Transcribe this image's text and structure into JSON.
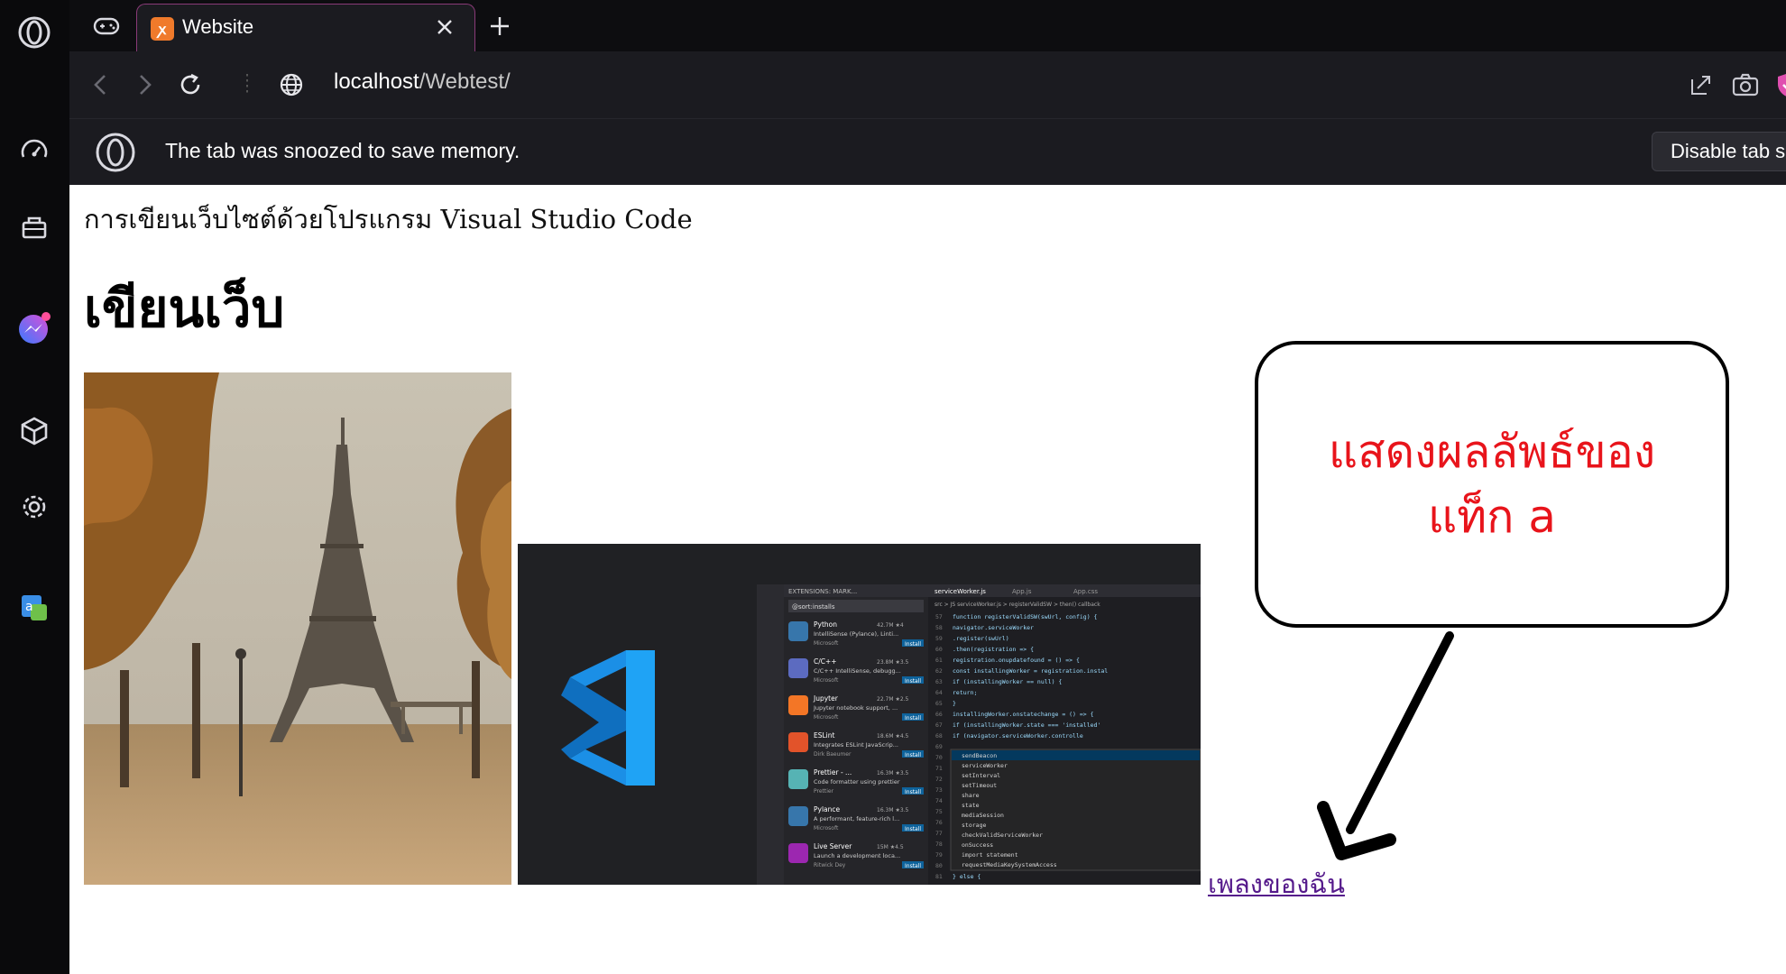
{
  "browser": {
    "tab": {
      "title": "Website",
      "favicon_glyph": "XAMPP"
    },
    "address": {
      "host": "localhost",
      "path": "/Webtest/"
    },
    "infobar": {
      "message": "The tab was snoozed to save memory.",
      "button_label": "Disable tab s"
    },
    "sidebar": {
      "items": [
        "opera-logo-icon",
        "speed-dial-icon",
        "shopping-bag-icon",
        "messenger-icon",
        "cube-icon",
        "settings-icon",
        "translate-icon"
      ]
    }
  },
  "page": {
    "intro_text": "การเขียนเว็บไซต์ด้วยโปรแกรม Visual Studio Code",
    "heading": "เขียนเว็บ",
    "link_text": "เพลงของฉัน"
  },
  "vscode_screenshot": {
    "panel_title": "EXTENSIONS: MARK...",
    "search": "@sort:installs",
    "tabs": [
      "serviceWorker.js",
      "App.js",
      "App.css"
    ],
    "breadcrumb": "src > JS serviceWorker.js > registerValidSW > then() callback",
    "extensions": [
      {
        "name": "Python",
        "desc": "IntelliSense (Pylance), Linti...",
        "publisher": "Microsoft",
        "stats": "42.7M ★4",
        "action": "Install"
      },
      {
        "name": "C/C++",
        "desc": "C/C++ IntelliSense, debugg...",
        "publisher": "Microsoft",
        "stats": "23.8M ★3.5",
        "action": "Install"
      },
      {
        "name": "Jupyter",
        "desc": "Jupyter notebook support, ...",
        "publisher": "Microsoft",
        "stats": "22.7M ★2.5",
        "action": "Install"
      },
      {
        "name": "ESLint",
        "desc": "Integrates ESLint JavaScrip...",
        "publisher": "Dirk Baeumer",
        "stats": "18.6M ★4.5",
        "action": "Install"
      },
      {
        "name": "Prettier - ...",
        "desc": "Code formatter using prettier",
        "publisher": "Prettier",
        "stats": "16.3M ★3.5",
        "action": "Install"
      },
      {
        "name": "Pylance",
        "desc": "A performant, feature-rich l...",
        "publisher": "Microsoft",
        "stats": "16.3M ★3.5",
        "action": "Install"
      },
      {
        "name": "Live Server",
        "desc": "Launch a development loca...",
        "publisher": "Ritwick Dey",
        "stats": "15M ★4.5",
        "action": "Install"
      }
    ],
    "line_numbers": [
      "57",
      "58",
      "59",
      "60",
      "61",
      "62",
      "63",
      "64",
      "65",
      "66",
      "67",
      "68",
      "69",
      "70",
      "71",
      "72",
      "73",
      "74",
      "75",
      "76",
      "77",
      "78",
      "79",
      "80",
      "81"
    ],
    "code_lines": [
      "function registerValidSW(swUrl, config) {",
      "  navigator.serviceWorker",
      "    .register(swUrl)",
      "    .then(registration => {",
      "      registration.onupdatefound = () => {",
      "        const installingWorker = registration.instal",
      "        if (installingWorker == null) {",
      "          return;",
      "        }",
      "        installingWorker.onstatechange = () => {",
      "          if (installingWorker.state === 'installed'",
      "            if (navigator.serviceWorker.controlle",
      "",
      "",
      "",
      "",
      "",
      "",
      "",
      "",
      "",
      "",
      "",
      "",
      "            } else {"
    ],
    "suggestions": [
      "sendBeacon",
      "serviceWorker",
      "setInterval",
      "setTimeout",
      "share",
      "state",
      "mediaSession",
      "storage",
      "checkValidServiceWorker",
      "onSuccess",
      "import statement",
      "requestMediaKeySystemAccess"
    ]
  },
  "annotation": {
    "callout_line1": "แสดงผลลัพธ์ของ",
    "callout_line2": "แท็ก a",
    "text_color": "#e8141b"
  },
  "colors": {
    "accent": "#8a3a78",
    "chrome_bg": "#1b1b20",
    "link": "#551a8b"
  }
}
